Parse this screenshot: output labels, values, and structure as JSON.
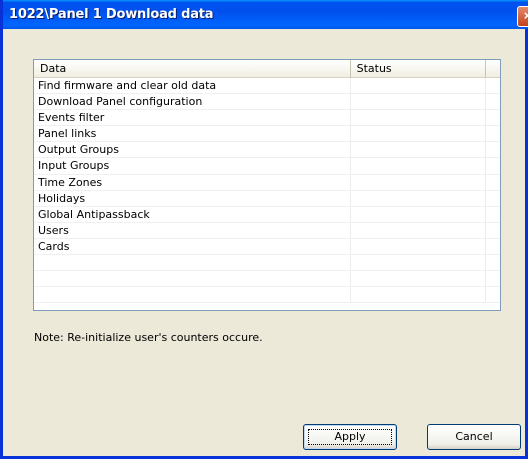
{
  "window": {
    "title": "1022\\Panel 1 Download data",
    "close_glyph": "×"
  },
  "list": {
    "columns": [
      "Data",
      "Status",
      ""
    ],
    "rows": [
      {
        "data": "Find firmware and clear old data",
        "status": ""
      },
      {
        "data": "Download Panel configuration",
        "status": ""
      },
      {
        "data": "Events filter",
        "status": ""
      },
      {
        "data": "Panel links",
        "status": ""
      },
      {
        "data": "Output Groups",
        "status": ""
      },
      {
        "data": "Input Groups",
        "status": ""
      },
      {
        "data": "Time Zones",
        "status": ""
      },
      {
        "data": "Holidays",
        "status": ""
      },
      {
        "data": "Global Antipassback",
        "status": ""
      },
      {
        "data": "Users",
        "status": ""
      },
      {
        "data": "Cards",
        "status": ""
      },
      {
        "data": "",
        "status": ""
      },
      {
        "data": "",
        "status": ""
      },
      {
        "data": "",
        "status": ""
      }
    ]
  },
  "note": "Note: Re-initialize user's counters occure.",
  "buttons": {
    "apply": "Apply",
    "cancel": "Cancel"
  }
}
